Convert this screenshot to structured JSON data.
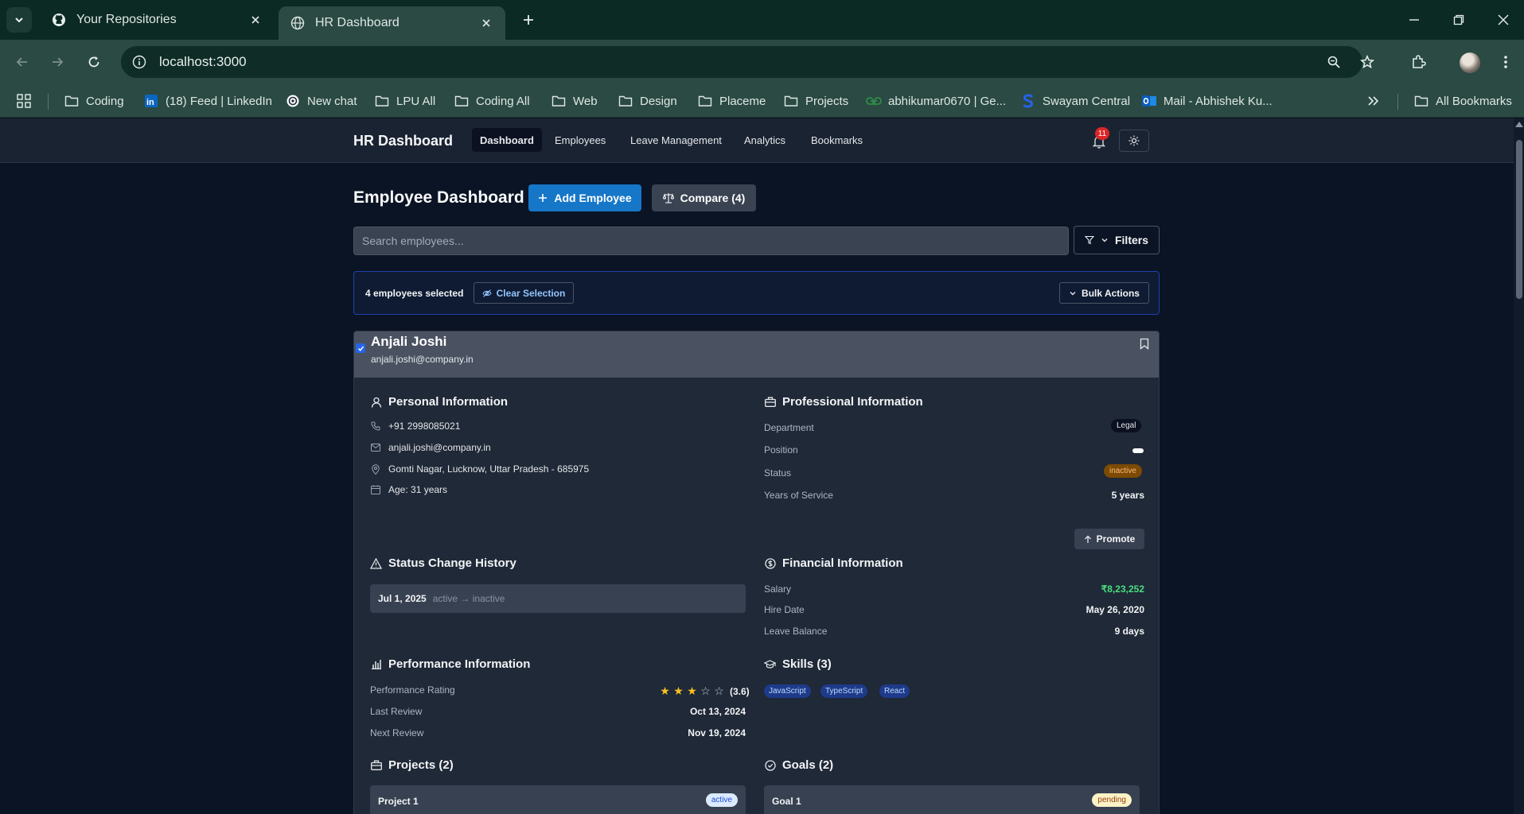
{
  "browser": {
    "tabs": [
      {
        "title": "Your Repositories",
        "icon": "github-icon"
      },
      {
        "title": "HR Dashboard",
        "icon": "globe-icon"
      }
    ],
    "url": "localhost:3000",
    "bookmarks": [
      {
        "label": "Coding",
        "icon": "folder-icon"
      },
      {
        "label": "(18) Feed | LinkedIn",
        "icon": "linkedin-icon"
      },
      {
        "label": "New chat",
        "icon": "chatgpt-icon"
      },
      {
        "label": "LPU All",
        "icon": "folder-icon"
      },
      {
        "label": "Coding All",
        "icon": "folder-icon"
      },
      {
        "label": "Web",
        "icon": "folder-icon"
      },
      {
        "label": "Design",
        "icon": "folder-icon"
      },
      {
        "label": "Placeme",
        "icon": "folder-icon"
      },
      {
        "label": "Projects",
        "icon": "folder-icon"
      },
      {
        "label": "abhikumar0670 | Ge...",
        "icon": "geeksforgeeks-icon"
      },
      {
        "label": "Swayam Central",
        "icon": "swayam-icon"
      },
      {
        "label": "Mail - Abhishek Ku...",
        "icon": "outlook-icon"
      }
    ],
    "all_bookmarks": "All Bookmarks"
  },
  "app": {
    "brand": "HR Dashboard",
    "nav": [
      "Dashboard",
      "Employees",
      "Leave Management",
      "Analytics",
      "Bookmarks"
    ],
    "active_nav": "Dashboard",
    "notifications": "11",
    "page_title": "Employee Dashboard",
    "add_employee": "Add Employee",
    "compare": "Compare (4)",
    "search_placeholder": "Search employees...",
    "filters": "Filters",
    "selection": {
      "count_text": "4 employees selected",
      "clear": "Clear Selection",
      "bulk": "Bulk Actions"
    },
    "employee": {
      "name": "Anjali Joshi",
      "email": "anjali.joshi@company.in",
      "selected": true,
      "personal": {
        "title": "Personal Information",
        "phone": "+91 2998085021",
        "email": "anjali.joshi@company.in",
        "address": "Gomti Nagar, Lucknow, Uttar Pradesh - 685975",
        "age": "Age: 31 years"
      },
      "professional": {
        "title": "Professional Information",
        "department_label": "Department",
        "department": "Legal",
        "position_label": "Position",
        "status_label": "Status",
        "status": "inactive",
        "years_label": "Years of Service",
        "years": "5 years",
        "promote": "Promote"
      },
      "status_history": {
        "title": "Status Change History",
        "date": "Jul 1, 2025",
        "change": "active → inactive"
      },
      "financial": {
        "title": "Financial Information",
        "salary_label": "Salary",
        "salary": "₹8,23,252",
        "hire_label": "Hire Date",
        "hire": "May 26, 2020",
        "leave_label": "Leave Balance",
        "leave": "9 days"
      },
      "performance": {
        "title": "Performance Information",
        "rating_label": "Performance Rating",
        "rating": 3.6,
        "rating_text": "(3.6)",
        "stars_filled": 3,
        "stars_total": 5,
        "last_label": "Last Review",
        "last": "Oct 13, 2024",
        "next_label": "Next Review",
        "next": "Nov 19, 2024"
      },
      "skills": {
        "title": "Skills (3)",
        "items": [
          "JavaScript",
          "TypeScript",
          "React"
        ]
      },
      "projects": {
        "title": "Projects (2)",
        "first": {
          "name": "Project 1",
          "status": "active"
        }
      },
      "goals": {
        "title": "Goals (2)",
        "first": {
          "name": "Goal 1",
          "status": "pending"
        }
      }
    }
  },
  "colors": {
    "accent": "#1677c8",
    "salary": "#4ade80",
    "star": "#fbbf24",
    "badge": "#dc2626"
  }
}
